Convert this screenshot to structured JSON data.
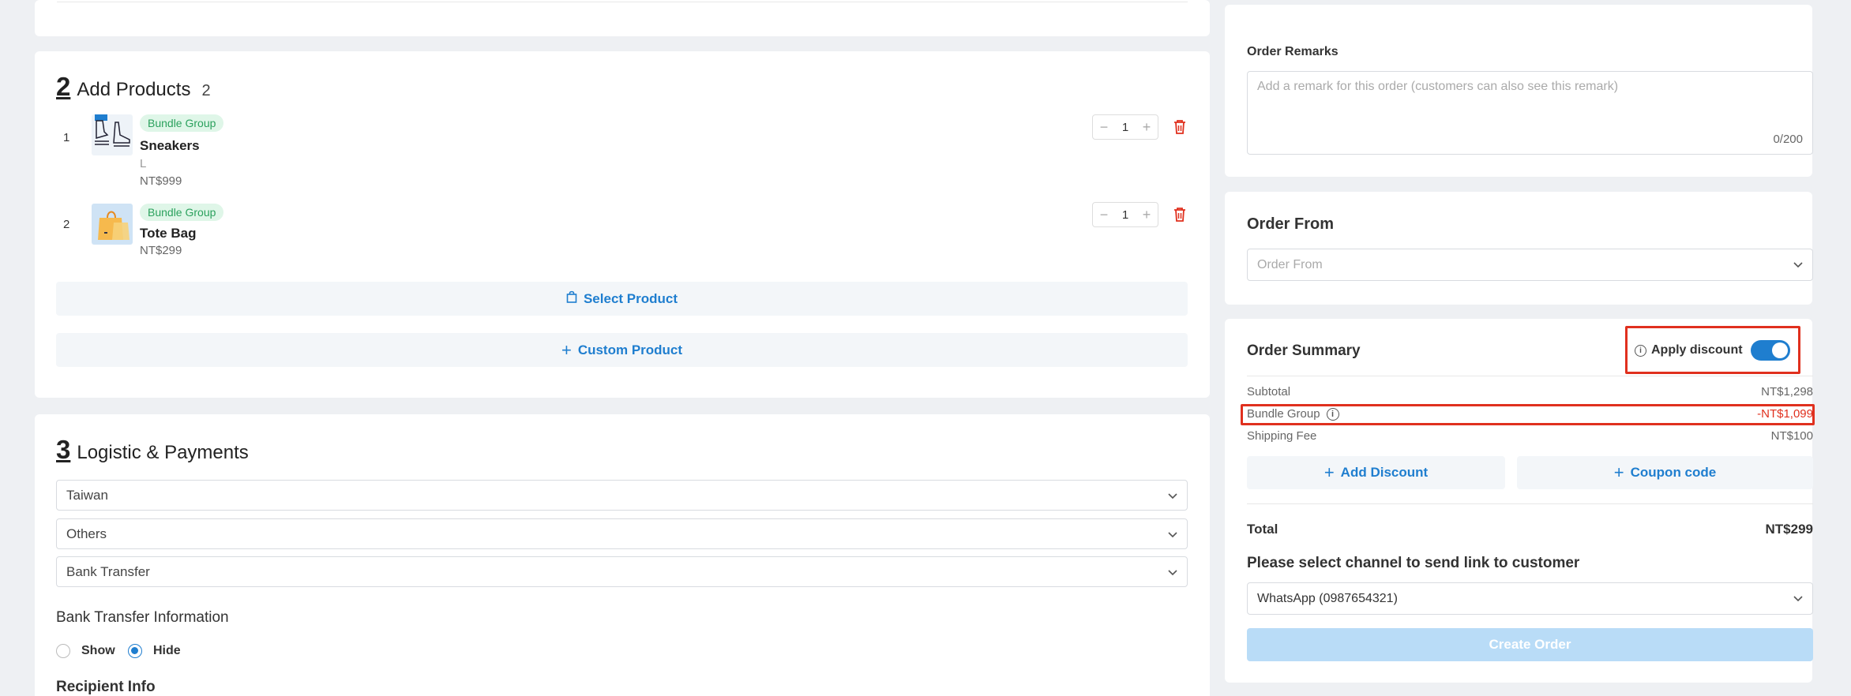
{
  "products": {
    "step_number": "2",
    "title": "Add Products",
    "count": "2",
    "items": [
      {
        "index": "1",
        "badge": "Bundle Group",
        "name": "Sneakers",
        "variant": "L",
        "price": "NT$999",
        "qty": "1"
      },
      {
        "index": "2",
        "badge": "Bundle Group",
        "name": "Tote Bag",
        "variant": "",
        "price": "NT$299",
        "qty": "1"
      }
    ],
    "select_product": "Select Product",
    "custom_product": "Custom Product"
  },
  "logistics": {
    "step_number": "3",
    "title": "Logistic & Payments",
    "country": "Taiwan",
    "delivery": "Others",
    "payment": "Bank Transfer",
    "bank_info_title": "Bank Transfer Information",
    "show_label": "Show",
    "hide_label": "Hide",
    "selected": "Hide",
    "recipient_title": "Recipient Info"
  },
  "remarks": {
    "title": "Order Remarks",
    "placeholder": "Add a remark for this order (customers can also see this remark)",
    "counter": "0/200"
  },
  "order_from": {
    "title": "Order From",
    "placeholder": "Order From"
  },
  "summary": {
    "title": "Order Summary",
    "apply_discount": "Apply discount",
    "apply_discount_on": true,
    "subtotal_label": "Subtotal",
    "subtotal_value": "NT$1,298",
    "bundle_label": "Bundle Group",
    "bundle_value": "-NT$1,099",
    "shipping_label": "Shipping Fee",
    "shipping_value": "NT$100",
    "add_discount": "Add Discount",
    "coupon_code": "Coupon code",
    "total_label": "Total",
    "total_value": "NT$299",
    "channel_title": "Please select channel to send link to customer",
    "channel_value": "WhatsApp (0987654321)",
    "create_order": "Create Order"
  },
  "colors": {
    "accent": "#1f7ecf",
    "badge_bg": "#dff6e8",
    "badge_text": "#2ba15d",
    "delete": "#e0301e",
    "highlight_border": "#e0301e",
    "discount_text": "#e0301e"
  }
}
